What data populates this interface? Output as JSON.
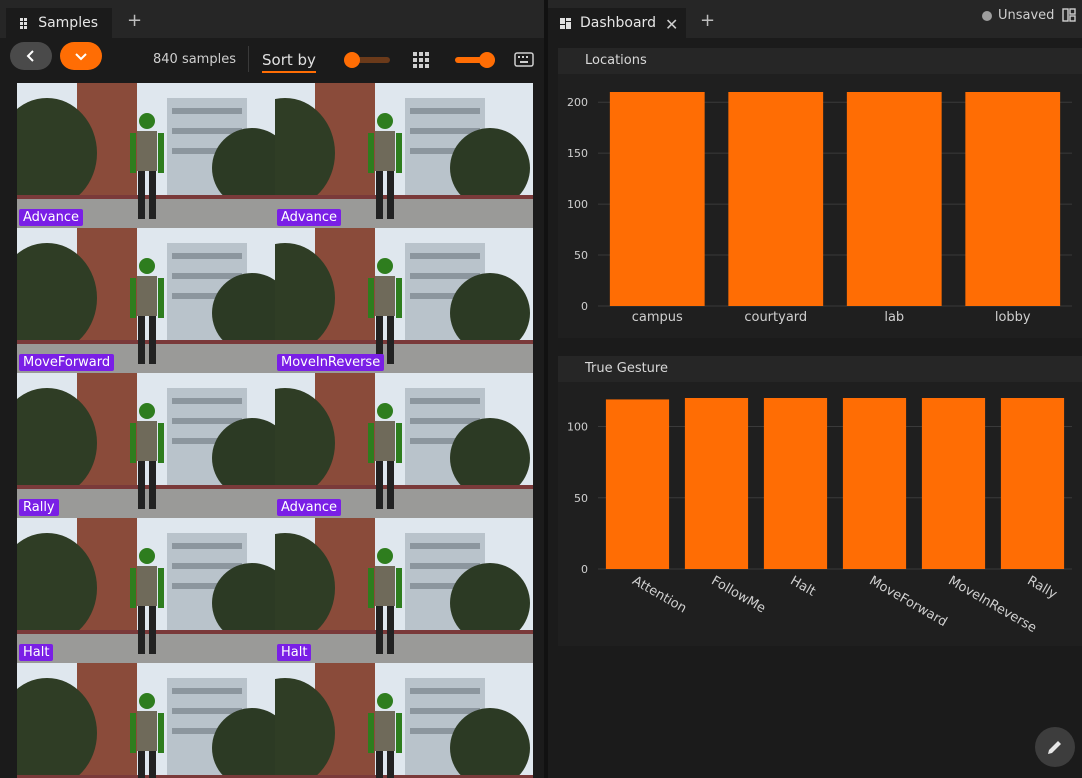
{
  "samples_tab": {
    "label": "Samples",
    "add": "+"
  },
  "toolbar": {
    "count": "840 samples",
    "sort_label": "Sort by"
  },
  "grid": {
    "cells": [
      {
        "label": "Advance"
      },
      {
        "label": "Advance"
      },
      {
        "label": "MoveForward"
      },
      {
        "label": "MoveInReverse"
      },
      {
        "label": "Rally"
      },
      {
        "label": "Advance"
      },
      {
        "label": "Halt"
      },
      {
        "label": "Halt"
      },
      {
        "label": ""
      },
      {
        "label": ""
      }
    ]
  },
  "dashboard": {
    "tab_label": "Dashboard",
    "close": "✕",
    "add": "+",
    "status": "Unsaved"
  },
  "colors": {
    "accent": "#ff6d04",
    "label_bg": "#7a1fe6"
  },
  "chart_data": [
    {
      "type": "bar",
      "title": "Locations",
      "categories": [
        "campus",
        "courtyard",
        "lab",
        "lobby"
      ],
      "values": [
        210,
        210,
        210,
        210
      ],
      "ylim": [
        0,
        210
      ],
      "yticks": [
        0,
        50,
        100,
        150,
        200
      ]
    },
    {
      "type": "bar",
      "title": "True Gesture",
      "categories": [
        "Attention",
        "FollowMe",
        "Halt",
        "MoveForward",
        "MoveInReverse",
        "Rally"
      ],
      "values": [
        119,
        120,
        120,
        120,
        120,
        120
      ],
      "ylim": [
        0,
        120
      ],
      "yticks": [
        0,
        50,
        100
      ]
    }
  ]
}
